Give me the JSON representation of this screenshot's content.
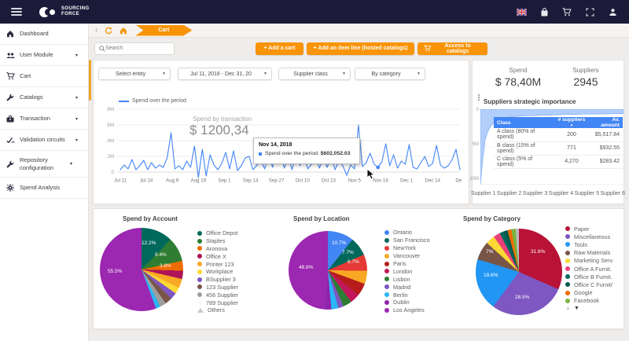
{
  "topbar": {
    "brand_line1": "SOURCING",
    "brand_line2": "FORCE"
  },
  "sidebar": {
    "items": [
      {
        "label": "Dashboard"
      },
      {
        "label": "User Module",
        "caret": "▾"
      },
      {
        "label": "Cart"
      },
      {
        "label": "Catalogs",
        "caret": "▾"
      },
      {
        "label": "Transaction",
        "caret": "▾"
      },
      {
        "label": "Validation circuits",
        "caret": "▾"
      },
      {
        "label": "Repository configuration",
        "caret": "▾"
      },
      {
        "label": "Spend Analysis"
      }
    ]
  },
  "breadcrumb": {
    "back_glyph": "‹",
    "tab_label": "Cart"
  },
  "toolbar": {
    "search_placeholder": "Search",
    "add_cart_label": "+   Add a cart",
    "add_item_line_label": "+   Add an item line (hosted catalogs)",
    "access_catalogs_label": "Access to catalogs"
  },
  "filters": {
    "entity": "Select entity",
    "date_range": "Jul 11, 2018 - Dec 31, 20",
    "supplier_class": "Supplier class",
    "category": "By category",
    "caret": "▼"
  },
  "stats": {
    "spend_label": "Spend",
    "spend_value": "$ 78,40M",
    "suppliers_label": "Suppliers",
    "suppliers_value": "2945"
  },
  "line_chart": {
    "legend": "Spend over the period",
    "overlay_title": "Spend by transaction",
    "overlay_value": "$ 1200,34",
    "tooltip": {
      "date": "Nov 14, 2018",
      "series_label": "Spend over the period:",
      "value": "$602,052.03"
    }
  },
  "suppliers_panel": {
    "title": "Suppliers strategic importance",
    "y_ticks": [
      "0",
      "5M",
      "10M"
    ],
    "table": {
      "headers": [
        "Class",
        "# suppliers",
        "Av. amount"
      ],
      "sort_caret": "▼",
      "rows": [
        [
          "A class (80% of spend)",
          "200",
          "$5,517.84"
        ],
        [
          "B class (15% of spend)",
          "771",
          "$932.55"
        ],
        [
          "C class (5% of spend)",
          "4,270",
          "$283.42"
        ]
      ]
    },
    "x_labels": [
      "Supplier 1",
      "Supplier 2",
      "Supplier 3",
      "Supplier 4",
      "Supplier 5",
      "Supplier 6"
    ]
  },
  "pies_footer": {
    "up": "▲",
    "down": "▼"
  },
  "chart_data": [
    {
      "id": "spend-line",
      "type": "line",
      "title": "Spend over the period",
      "unit": "millions USD",
      "ylim": [
        0,
        8000000
      ],
      "y_ticks": [
        "0",
        "2M",
        "4M",
        "6M",
        "8M"
      ],
      "x_ticks": [
        "Jul 11",
        "Jul 24",
        "Aug 6",
        "Aug 19",
        "Sep 1",
        "Sep 14",
        "Sep 27",
        "Oct 10",
        "Oct 23",
        "Nov 5",
        "Nov 18",
        "Dec 1",
        "Dec 14",
        "De"
      ],
      "values": [
        0.3,
        0.9,
        0.4,
        1.6,
        0.3,
        0.8,
        1.5,
        0.3,
        1.2,
        0.5,
        0.9,
        0.6,
        1.8,
        5.0,
        0.4,
        0.8,
        0.3,
        1.4,
        0.6,
        3.3,
        -0.7,
        2.9,
        -0.5,
        2.2,
        0.9,
        0.3,
        1.1,
        2.5,
        0.4,
        2.7,
        0.2,
        0.8,
        1.8,
        2.0,
        0.3,
        0.9,
        1.5,
        0.4,
        2.2,
        0.6,
        2.8,
        2.4,
        0.5,
        1.9,
        0.3,
        2.6,
        0.8,
        2.4,
        0.4,
        1.0,
        2.3,
        0.5,
        1.8,
        0.6,
        2.0,
        0.3,
        1.5,
        0.8,
        -0.4,
        0.9,
        0.4,
        6.0,
        0.7,
        1.2,
        2.4,
        1.0,
        0.6,
        1.3,
        3.6,
        0.8,
        2.2,
        0.5,
        1.4,
        1.0,
        3.5,
        0.6,
        0.4,
        1.2,
        2.0,
        0.7,
        1.1,
        3.4,
        0.9,
        0.5,
        0.8,
        1.6,
        2.9,
        0.3
      ],
      "highlight_index": 66,
      "highlight_value": 0.602
    },
    {
      "id": "suppliers-distribution",
      "type": "area",
      "title": "Suppliers strategic importance",
      "unit": "millions USD",
      "ylim": [
        0,
        10000000
      ],
      "inverted_axis": true,
      "values": [
        10,
        6.5,
        4,
        3,
        2.4,
        2,
        1.7,
        1.5,
        1.35,
        1.25,
        1.15,
        1.1,
        1.05,
        1.0,
        0.97,
        0.95,
        0.93,
        0.91,
        0.89,
        0.87,
        0.86,
        0.85,
        0.84,
        0.83,
        0.82,
        0.81,
        0.8,
        0.79,
        0.78,
        0.77,
        0.76,
        0.75,
        0.74,
        0.73,
        0.72,
        0.71,
        0.7,
        0.7,
        0.69,
        0.68,
        0.68,
        0.67,
        0.66,
        0.66,
        0.65,
        0.65,
        0.64,
        0.64,
        0.63,
        0.63,
        0.62,
        0.62,
        0.61,
        0.61,
        0.6,
        0.6,
        0.59,
        0.59,
        0.58,
        0.58
      ]
    },
    {
      "id": "pie-account",
      "type": "pie",
      "title": "Spend by Account",
      "slices": [
        {
          "label": "Office Depot",
          "value": 12.2,
          "color": "#00695c"
        },
        {
          "label": "Staples",
          "value": 9.4,
          "color": "#2e7d32"
        },
        {
          "label": "Aronova",
          "value": 3.8,
          "color": "#ef6c00"
        },
        {
          "label": "Office X",
          "value": 3.2,
          "color": "#ad1457"
        },
        {
          "label": "Printer 123",
          "value": 3.6,
          "color": "#f9a825"
        },
        {
          "label": "Workplace",
          "value": 2.4,
          "color": "#fdd835"
        },
        {
          "label": "BSupplier 3",
          "value": 2.6,
          "color": "#7e57c2"
        },
        {
          "label": "123 Supplier",
          "value": 2.8,
          "color": "#795548"
        },
        {
          "label": "456 Supplier",
          "value": 2.4,
          "color": "#9e9e9e"
        },
        {
          "label": "789 Supplier",
          "value": 1.8,
          "color": "#29b6f6",
          "legend_marker_color": "#fafafa"
        },
        {
          "label": "Others",
          "value": 55.5,
          "color": "#9c27b0",
          "marker": "triangle"
        }
      ],
      "shown_labels": [
        "12.2%",
        "9.4%",
        "3.8%",
        "55.5%"
      ]
    },
    {
      "id": "pie-location",
      "type": "pie",
      "title": "Spend by Location",
      "slices": [
        {
          "label": "Ontario",
          "value": 10.7,
          "color": "#4285f4"
        },
        {
          "label": "San Francisco",
          "value": 7.7,
          "color": "#00695c"
        },
        {
          "label": "NewYork",
          "value": 6.7,
          "color": "#e53935"
        },
        {
          "label": "Vancouver",
          "value": 5.4,
          "color": "#f9a825"
        },
        {
          "label": "Paris",
          "value": 5.2,
          "color": "#b71c1c"
        },
        {
          "label": "London",
          "value": 4.0,
          "color": "#c2185b"
        },
        {
          "label": "Lisbon",
          "value": 3.6,
          "color": "#2e7d32"
        },
        {
          "label": "Madrid",
          "value": 2.2,
          "color": "#7e57c2"
        },
        {
          "label": "Berlin",
          "value": 2.9,
          "color": "#29b6f6"
        },
        {
          "label": "Dublin",
          "value": 2.4,
          "color": "#8e24aa"
        },
        {
          "label": "Los Angeles",
          "value": 48.8,
          "color": "#9c27b0"
        }
      ],
      "shown_labels": [
        "10.7%",
        "7.7%",
        "6.7%",
        "48.8%"
      ]
    },
    {
      "id": "pie-category",
      "type": "pie",
      "title": "Spend by Category",
      "slices": [
        {
          "label": "Paper",
          "value": 31.6,
          "color": "#b81237"
        },
        {
          "label": "Miscellaneous",
          "value": 28.5,
          "color": "#7e57c2"
        },
        {
          "label": "Tools",
          "value": 19.6,
          "color": "#2196f3"
        },
        {
          "label": "Raw Materials",
          "value": 7.0,
          "color": "#795548"
        },
        {
          "label": "Marketing Serv.",
          "value": 3.4,
          "color": "#fdd835"
        },
        {
          "label": "Office A Furnit.",
          "value": 2.6,
          "color": "#ec407a"
        },
        {
          "label": "Office B Furnit.",
          "value": 1.6,
          "color": "#00695c"
        },
        {
          "label": "Office C Furnit/",
          "value": 1.4,
          "color": "#00594f"
        },
        {
          "label": "Google",
          "value": 1.5,
          "color": "#ef6c00"
        },
        {
          "label": "Facebook",
          "value": 1.6,
          "color": "#7cb342"
        },
        {
          "label": "",
          "value": 1.2,
          "color": "#bdbdbd",
          "legend": false
        }
      ],
      "shown_labels": [
        "31.6%",
        "28.5%",
        "19.6%",
        "7%"
      ]
    }
  ]
}
